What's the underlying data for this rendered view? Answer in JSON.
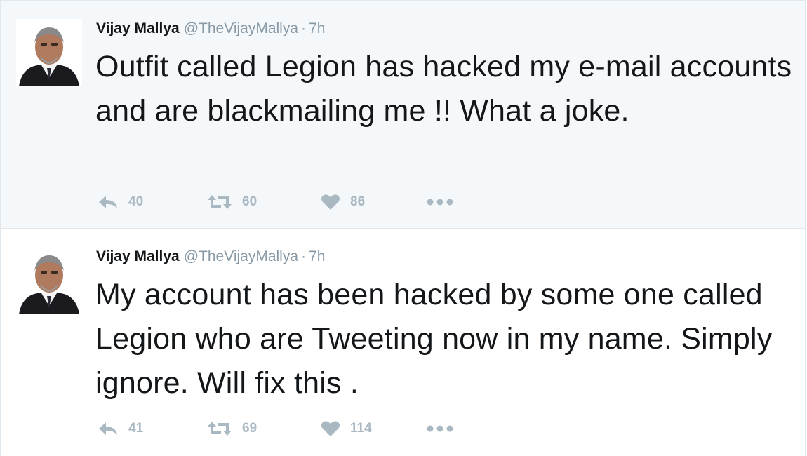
{
  "tweets": [
    {
      "author": {
        "name": "Vijay Mallya",
        "handle": "@TheVijayMallya",
        "separator": "·",
        "time": "7h"
      },
      "text": "Outfit called Legion has hacked my e-mail accounts and are blackmailing me !! What a joke.",
      "stats": {
        "replies": "40",
        "retweets": "60",
        "likes": "86"
      }
    },
    {
      "author": {
        "name": "Vijay Mallya",
        "handle": "@TheVijayMallya",
        "separator": "·",
        "time": "7h"
      },
      "text": "My account has been hacked by some one called Legion who are Tweeting now in my name. Simply ignore. Will fix this .",
      "stats": {
        "replies": "41",
        "retweets": "69",
        "likes": "114"
      }
    }
  ],
  "icons": {
    "reply": "reply-icon",
    "retweet": "retweet-icon",
    "like": "heart-icon",
    "more": "more-dots-icon"
  },
  "colors": {
    "background_highlight": "#f5f8fa",
    "text": "#14171a",
    "secondary_text": "#8899a6",
    "action_gray": "#aab8c2"
  }
}
